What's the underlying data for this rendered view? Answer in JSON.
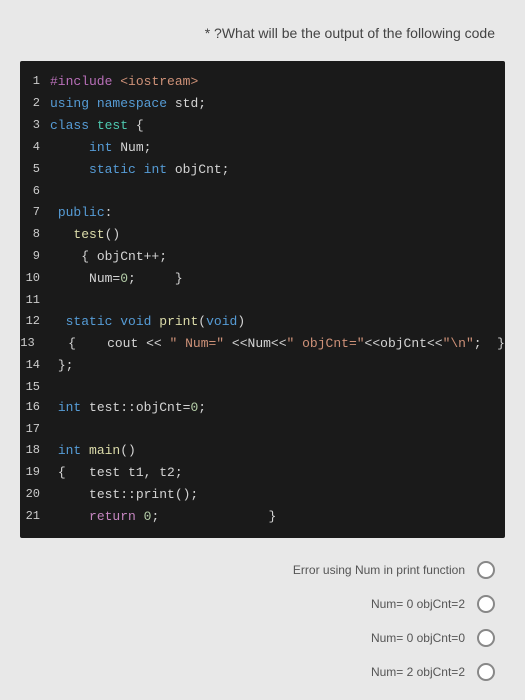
{
  "question": "* ?What will be the output of the following code",
  "code": {
    "lines": [
      {
        "n": 1,
        "html": "<span class='kw-preproc'>#include</span> <span class='t-str'>&lt;iostream&gt;</span>"
      },
      {
        "n": 2,
        "html": "<span class='kw-blue'>using</span> <span class='kw-blue'>namespace</span> <span class='t-white'>std;</span>"
      },
      {
        "n": 3,
        "html": "<span class='kw-blue'>class</span> <span class='t-teal'>test</span> <span class='t-white'>{</span>"
      },
      {
        "n": 4,
        "html": "     <span class='kw-blue'>int</span> <span class='t-white'>Num;</span>"
      },
      {
        "n": 5,
        "html": "     <span class='kw-blue'>static</span> <span class='kw-blue'>int</span> <span class='t-white'>objCnt;</span>"
      },
      {
        "n": 6,
        "html": ""
      },
      {
        "n": 7,
        "html": " <span class='kw-blue'>public</span><span class='t-white'>:</span>"
      },
      {
        "n": 8,
        "html": "   <span class='t-yellow'>test</span><span class='t-white'>()</span>"
      },
      {
        "n": 9,
        "html": "    <span class='t-white'>{ objCnt++;</span>"
      },
      {
        "n": 10,
        "html": "     <span class='t-white'>Num=</span><span class='t-num'>0</span><span class='t-white'>;     }</span>"
      },
      {
        "n": 11,
        "html": ""
      },
      {
        "n": 12,
        "html": "  <span class='kw-blue'>static</span> <span class='kw-blue'>void</span> <span class='t-yellow'>print</span><span class='t-white'>(</span><span class='kw-blue'>void</span><span class='t-white'>)</span>"
      },
      {
        "n": 13,
        "html": "   <span class='t-white'>{    cout &lt;&lt; </span><span class='t-str'>\" Num=\"</span><span class='t-white'> &lt;&lt;Num&lt;&lt;</span><span class='t-str'>\" objCnt=\"</span><span class='t-white'>&lt;&lt;objCnt&lt;&lt;</span><span class='t-str'>\"\\n\"</span><span class='t-white'>;  }</span>"
      },
      {
        "n": 14,
        "html": " <span class='t-white'>};</span>"
      },
      {
        "n": 15,
        "html": ""
      },
      {
        "n": 16,
        "html": " <span class='kw-blue'>int</span> <span class='t-white'>test::objCnt=</span><span class='t-num'>0</span><span class='t-white'>;</span>"
      },
      {
        "n": 17,
        "html": ""
      },
      {
        "n": 18,
        "html": " <span class='kw-blue'>int</span> <span class='t-yellow'>main</span><span class='t-white'>()</span>"
      },
      {
        "n": 19,
        "html": " <span class='t-white'>{   test t1, t2;</span>"
      },
      {
        "n": 20,
        "html": "     <span class='t-white'>test::print();</span>"
      },
      {
        "n": 21,
        "html": "     <span class='t-purple'>return</span> <span class='t-num'>0</span><span class='t-white'>;</span>              <span class='t-white'>}</span>"
      }
    ]
  },
  "options": [
    {
      "label": "Error using Num in print function"
    },
    {
      "label": "Num= 0 objCnt=2"
    },
    {
      "label": "Num= 0 objCnt=0"
    },
    {
      "label": "Num= 2 objCnt=2"
    }
  ]
}
